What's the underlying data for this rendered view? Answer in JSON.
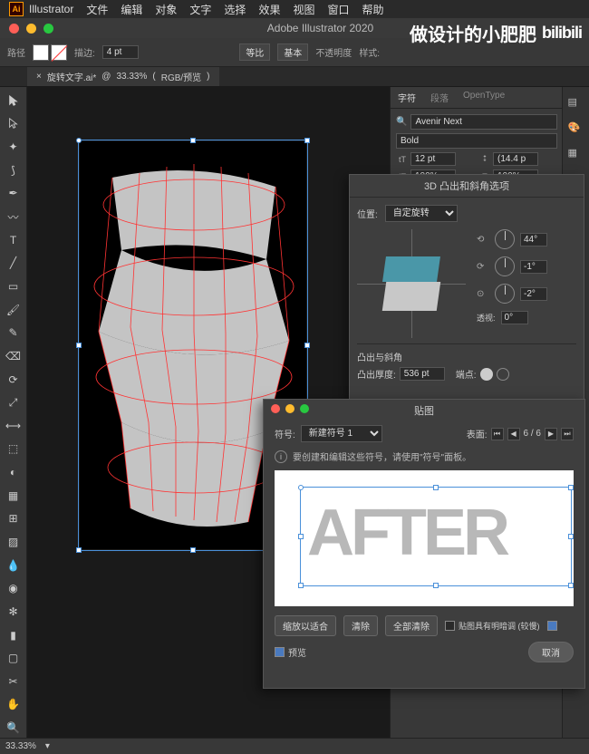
{
  "mac_menu": {
    "app": "Illustrator",
    "items": [
      "文件",
      "编辑",
      "对象",
      "文字",
      "选择",
      "效果",
      "视图",
      "窗口",
      "帮助"
    ]
  },
  "window_title": "Adobe Illustrator 2020",
  "watermark": {
    "text": "做设计的小肥肥",
    "site": "bilibili"
  },
  "control_bar": {
    "path_label": "路径",
    "stroke_label": "描边:",
    "stroke_width": "4 pt",
    "ratio_label": "等比",
    "style_label": "基本",
    "opacity_label": "不透明度",
    "fx_label": "样式:"
  },
  "doc_tab": {
    "name": "旋转文字.ai*",
    "zoom": "33.33%",
    "mode": "RGB/预览",
    "close": "×"
  },
  "char_panel": {
    "tabs": [
      "字符",
      "段落",
      "OpenType"
    ],
    "font": "Avenir Next",
    "weight": "Bold",
    "size": "12 pt",
    "leading": "(14.4 p",
    "tracking": "100%",
    "scale": "100%"
  },
  "dialog_3d": {
    "title": "3D 凸出和斜角选项",
    "position_label": "位置:",
    "position_value": "自定旋转",
    "rot_x": "44°",
    "rot_y": "-1°",
    "rot_z": "-2°",
    "perspective_label": "透视:",
    "perspective": "0°",
    "bevel_section": "凸出与斜角",
    "depth_label": "凸出厚度:",
    "depth": "536 pt",
    "cap_label": "端点:"
  },
  "dialog_map": {
    "title": "贴图",
    "symbol_label": "符号:",
    "symbol_value": "新建符号 1",
    "surface_label": "表面:",
    "surface_current": "6 / 6",
    "info_text": "要创建和编辑这些符号，请使用\"符号\"面板。",
    "preview_text": "AFTER",
    "btn_fit": "缩放以适合",
    "btn_clear": "清除",
    "btn_clear_all": "全部清除",
    "chk_shade": "贴图具有明暗调 (较慢)",
    "chk_preview": "预览",
    "btn_cancel": "取消"
  },
  "status": {
    "zoom": "33.33%"
  }
}
